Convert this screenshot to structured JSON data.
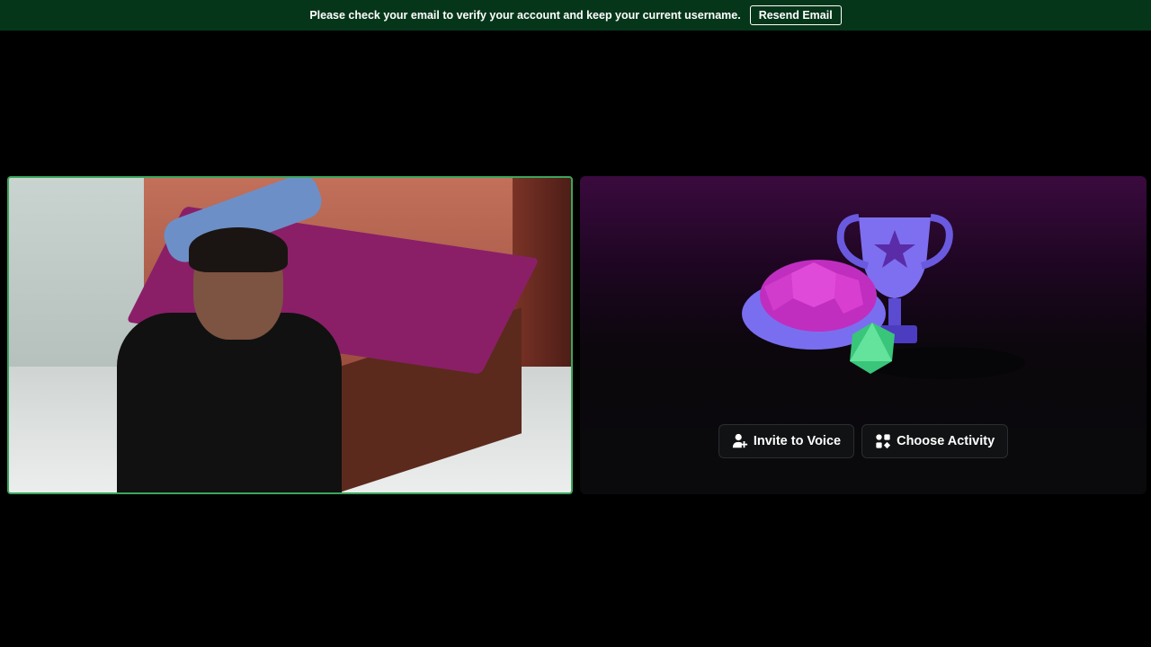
{
  "banner": {
    "message": "Please check your email to verify your account and keep your current username.",
    "resend_label": "Resend Email"
  },
  "video_tile": {
    "speaking": true,
    "speaking_color": "#3ba55d"
  },
  "activity_tile": {
    "invite_label": "Invite to Voice",
    "invite_icon": "add-person-icon",
    "choose_label": "Choose Activity",
    "choose_icon": "activity-icon"
  },
  "colors": {
    "banner_bg": "#06361a",
    "background": "#000000",
    "button_bg": "#111214"
  }
}
